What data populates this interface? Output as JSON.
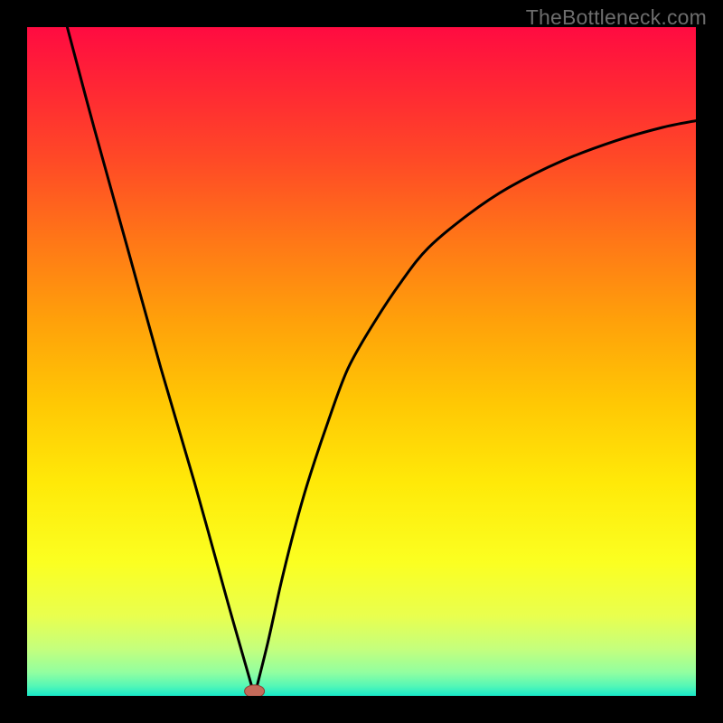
{
  "watermark": "TheBottleneck.com",
  "chart_data": {
    "type": "line",
    "title": "",
    "xlabel": "",
    "ylabel": "",
    "xlim": [
      0,
      100
    ],
    "ylim": [
      0,
      100
    ],
    "curve_left": {
      "x": [
        6,
        10,
        15,
        20,
        25,
        30,
        34
      ],
      "y": [
        100,
        85,
        67,
        49,
        32,
        14,
        0
      ]
    },
    "curve_right": {
      "x": [
        34,
        36,
        38,
        40,
        42,
        45,
        48,
        52,
        56,
        60,
        66,
        72,
        80,
        88,
        95,
        100
      ],
      "y": [
        0,
        8,
        17,
        25,
        32,
        41,
        49,
        56,
        62,
        67,
        72,
        76,
        80,
        83,
        85,
        86
      ]
    },
    "min_marker": {
      "x": 34,
      "y": 0.7
    },
    "background_gradient": {
      "stops": [
        {
          "offset": 0.0,
          "color": "#ff0b41"
        },
        {
          "offset": 0.1,
          "color": "#ff2a33"
        },
        {
          "offset": 0.2,
          "color": "#ff4a26"
        },
        {
          "offset": 0.32,
          "color": "#ff7717"
        },
        {
          "offset": 0.44,
          "color": "#ffa10a"
        },
        {
          "offset": 0.56,
          "color": "#ffc704"
        },
        {
          "offset": 0.68,
          "color": "#ffe908"
        },
        {
          "offset": 0.8,
          "color": "#fbff21"
        },
        {
          "offset": 0.88,
          "color": "#e9ff4e"
        },
        {
          "offset": 0.93,
          "color": "#c4ff7d"
        },
        {
          "offset": 0.965,
          "color": "#92ffa0"
        },
        {
          "offset": 0.985,
          "color": "#55f7b6"
        },
        {
          "offset": 1.0,
          "color": "#18e8c8"
        }
      ]
    },
    "colors": {
      "curve": "#000000",
      "marker_fill": "#c46a5a",
      "marker_stroke": "#8b3d32"
    }
  }
}
